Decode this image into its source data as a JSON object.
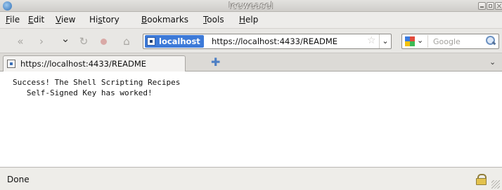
{
  "window": {
    "title": "Iceweasel"
  },
  "menubar": {
    "items": [
      {
        "pre": "",
        "key": "F",
        "post": "ile"
      },
      {
        "pre": "",
        "key": "E",
        "post": "dit"
      },
      {
        "pre": "",
        "key": "V",
        "post": "iew"
      },
      {
        "pre": "Hi",
        "key": "s",
        "post": "tory"
      },
      {
        "pre": "",
        "key": "B",
        "post": "ookmarks"
      },
      {
        "pre": "",
        "key": "T",
        "post": "ools"
      },
      {
        "pre": "",
        "key": "H",
        "post": "elp"
      }
    ]
  },
  "navigation": {
    "back_icon": "«",
    "forward_icon": "›",
    "history_dropdown_icon": "⌄",
    "reload_icon": "↻",
    "home_icon": "⌂"
  },
  "urlbar": {
    "site_identity": "localhost",
    "url": "https://localhost:4433/README",
    "bookmark_star": "☆",
    "dropdown_icon": "⌄"
  },
  "search": {
    "placeholder": "Google",
    "engine_dropdown_icon": "⌄"
  },
  "tabs": [
    {
      "label": "https://localhost:4433/README"
    }
  ],
  "tabbar": {
    "new_tab_icon": "✚",
    "list_all_tabs_icon": "⌄"
  },
  "content": {
    "text": "Success! The Shell Scripting Recipes\n   Self-Signed Key has worked!"
  },
  "status": {
    "text": "Done"
  },
  "colors": {
    "site_identity_bg": "#3d7ad8",
    "chrome_bg": "#e8e7e4"
  }
}
